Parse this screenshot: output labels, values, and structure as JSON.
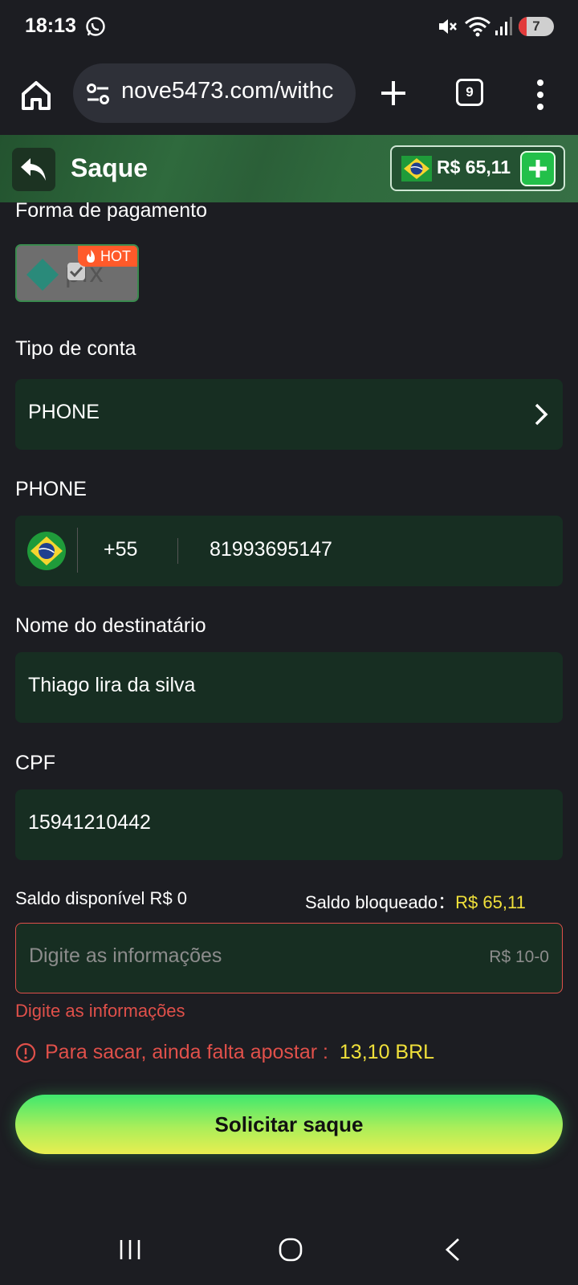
{
  "status_bar": {
    "time": "18:13",
    "battery_level": "7"
  },
  "browser": {
    "url": "nove5473.com/withc",
    "tab_count": "9"
  },
  "header": {
    "title": "Saque",
    "balance": "R$ 65,11"
  },
  "form": {
    "payment_method_label": "Forma de pagamento",
    "payment_method_badge": "HOT",
    "payment_method_name": "pix",
    "account_type_label": "Tipo de conta",
    "account_type_value": "PHONE",
    "phone_label": "PHONE",
    "phone_country_code": "+55",
    "phone_number": "81993695147",
    "recipient_label": "Nome do destinatário",
    "recipient_value": "Thiago lira da silva",
    "cpf_label": "CPF",
    "cpf_value": "15941210442",
    "available_balance_text": "Saldo disponível R$ 0",
    "blocked_balance_label": "Saldo bloqueado：",
    "blocked_balance_value": "R$ 65,11",
    "amount_placeholder": "Digite as informações",
    "amount_range": "R$ 10-0",
    "amount_error": "Digite as informações",
    "bet_warning_text": "Para sacar, ainda falta apostar :",
    "bet_warning_value": "13,10 BRL",
    "submit_label": "Solicitar saque"
  },
  "colors": {
    "background": "#1c1d22",
    "header_green": "#2f6a3d",
    "field_green": "#172e22",
    "error_red": "#e0504a",
    "highlight_yellow": "#f0e03a",
    "button_gradient_top": "#3fe86e",
    "button_gradient_bottom": "#e8ee50"
  }
}
